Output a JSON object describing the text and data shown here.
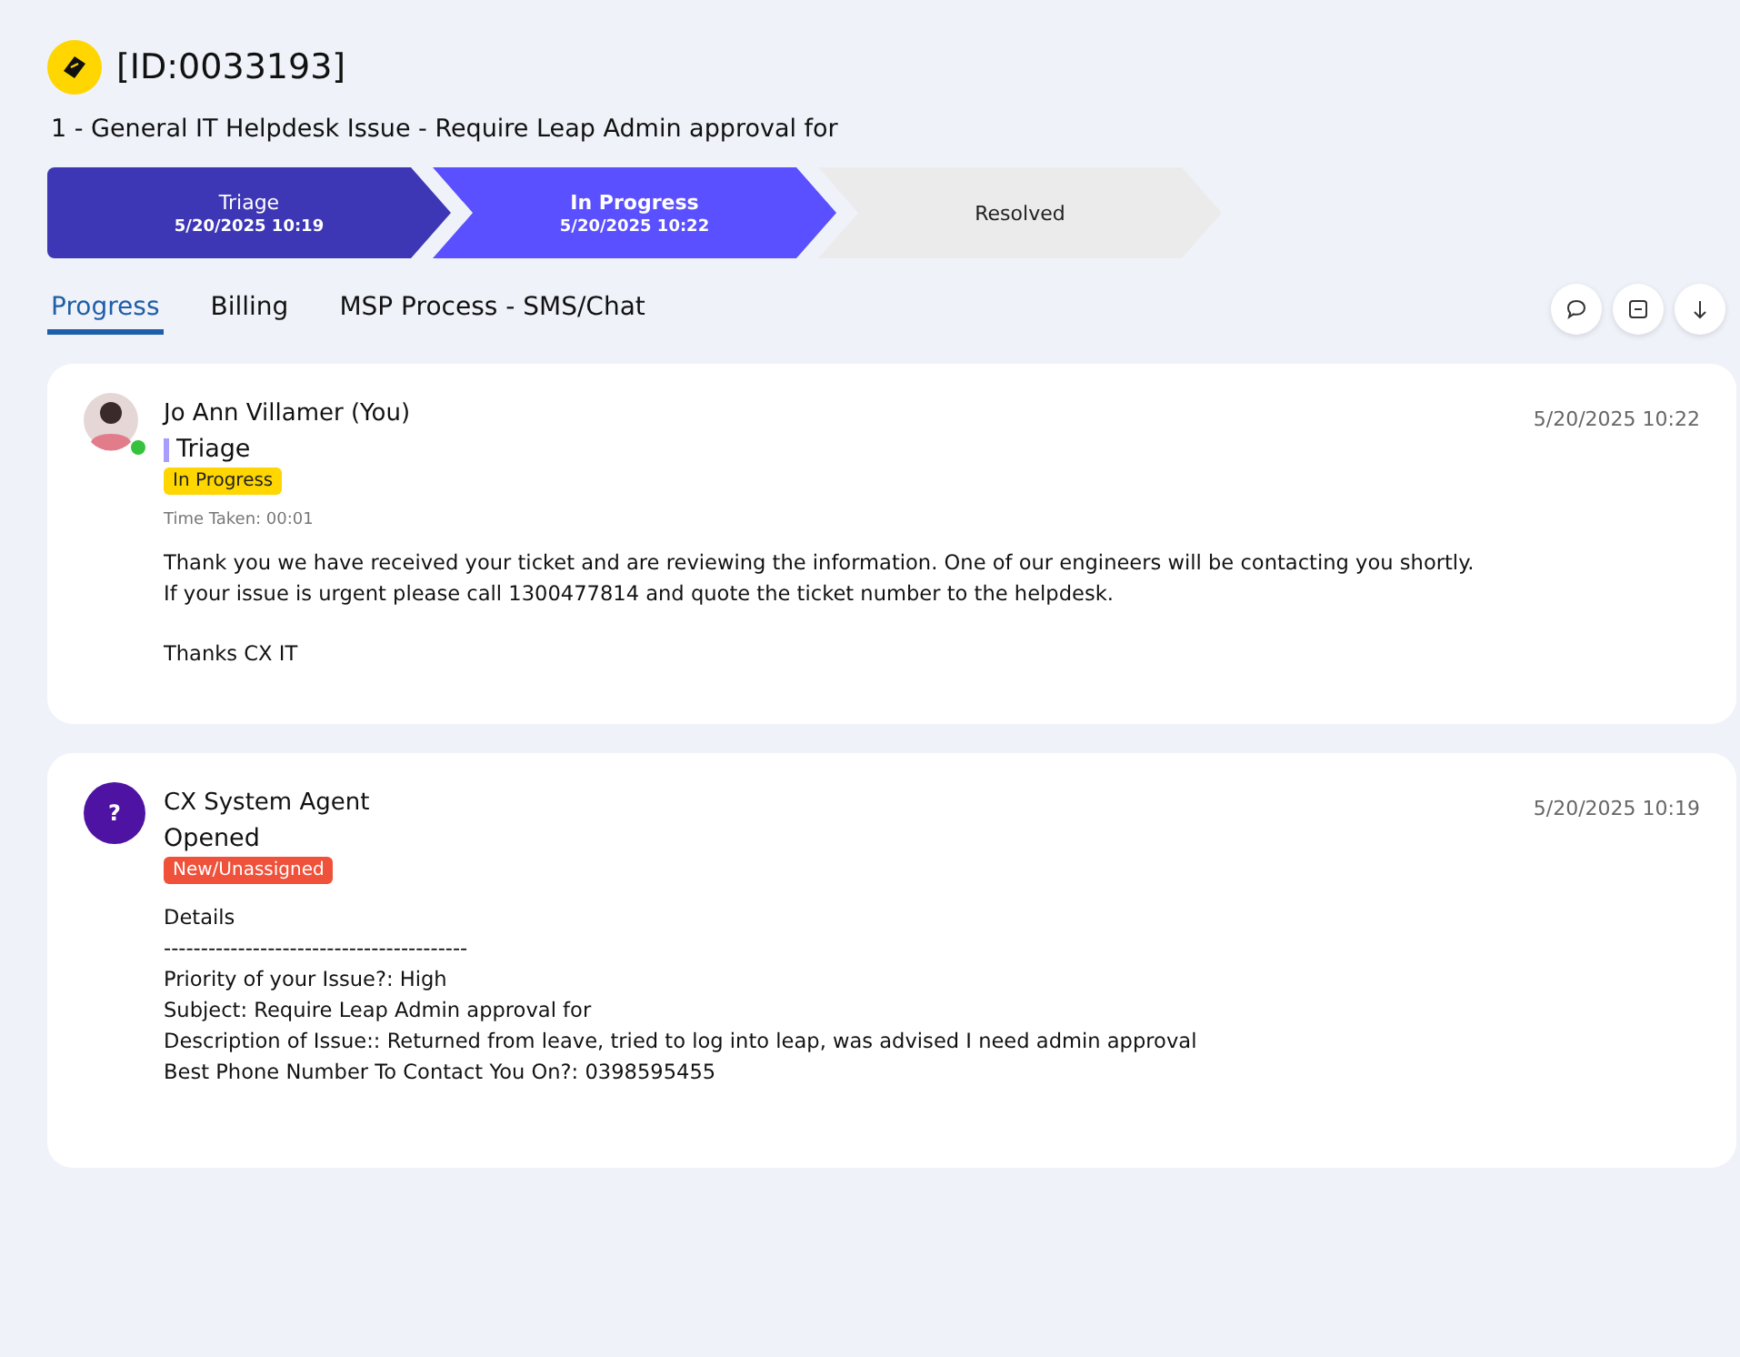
{
  "ticket": {
    "id": "[ID:0033193]",
    "title": "1 - General IT Helpdesk Issue - Require Leap Admin approval for"
  },
  "stages": [
    {
      "label": "Triage",
      "time": "5/20/2025 10:19",
      "kind": "done"
    },
    {
      "label": "In Progress",
      "time": "5/20/2025 10:22",
      "kind": "current"
    },
    {
      "label": "Resolved",
      "kind": "pending"
    }
  ],
  "tabs": [
    {
      "label": "Progress",
      "selected": true
    },
    {
      "label": "Billing",
      "selected": false
    },
    {
      "label": "MSP Process - SMS/Chat",
      "selected": false
    }
  ],
  "messages": [
    {
      "author": "Jo Ann Villamer (You)",
      "avatar": {
        "kind": "photo"
      },
      "online": true,
      "stage": "Triage",
      "stage_marker": true,
      "status": {
        "label": "In Progress",
        "color": "#ffd600"
      },
      "timestamp": "5/20/2025 10:22",
      "time_taken": "Time Taken: 00:01",
      "paragraphs": [
        [
          "Thank you we have received your ticket and are reviewing the information. One of our engineers will be contacting you shortly.",
          "If your issue is urgent please call 1300477814 and quote the ticket number to the helpdesk."
        ],
        [
          "Thanks CX IT"
        ]
      ]
    },
    {
      "author": "CX System Agent",
      "avatar": {
        "kind": "initial",
        "text": "?"
      },
      "online": false,
      "stage": "Opened",
      "stage_marker": false,
      "status": {
        "label": "New/Unassigned",
        "color": "#f0513a"
      },
      "timestamp": "5/20/2025 10:19",
      "paragraphs": [
        [
          "Details",
          "-----------------------------------------",
          "Priority of your Issue?: High",
          "Subject: Require Leap Admin approval for",
          "Description of Issue:: Returned from leave, tried to log into leap, was advised I need admin approval",
          "Best Phone Number To Contact You On?: 0398595455"
        ]
      ]
    }
  ]
}
